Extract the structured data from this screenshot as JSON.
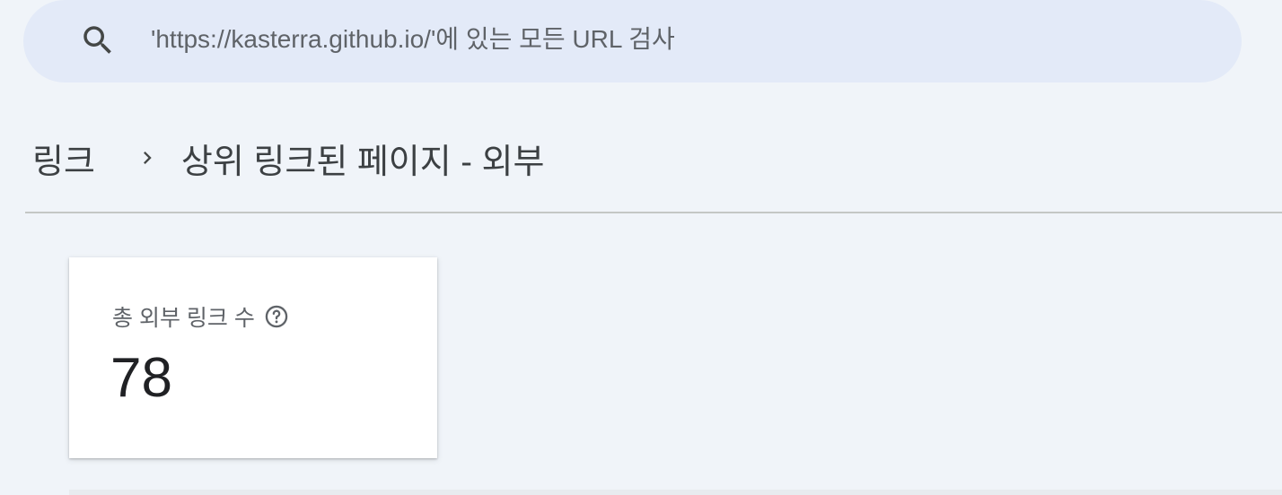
{
  "search": {
    "placeholder": "'https://kasterra.github.io/'에 있는 모든 URL 검사"
  },
  "breadcrumb": {
    "parent": "링크",
    "current": "상위 링크된 페이지 - 외부"
  },
  "summary_card": {
    "label": "총 외부 링크 수",
    "value": "78"
  },
  "icons": {
    "search": "search-icon",
    "chevron": "chevron-right-icon",
    "help": "help-circle-icon"
  },
  "colors": {
    "background": "#f0f4f9",
    "search_bar": "#e3eaf8",
    "text_primary": "#202124",
    "text_secondary": "#5f6368"
  }
}
